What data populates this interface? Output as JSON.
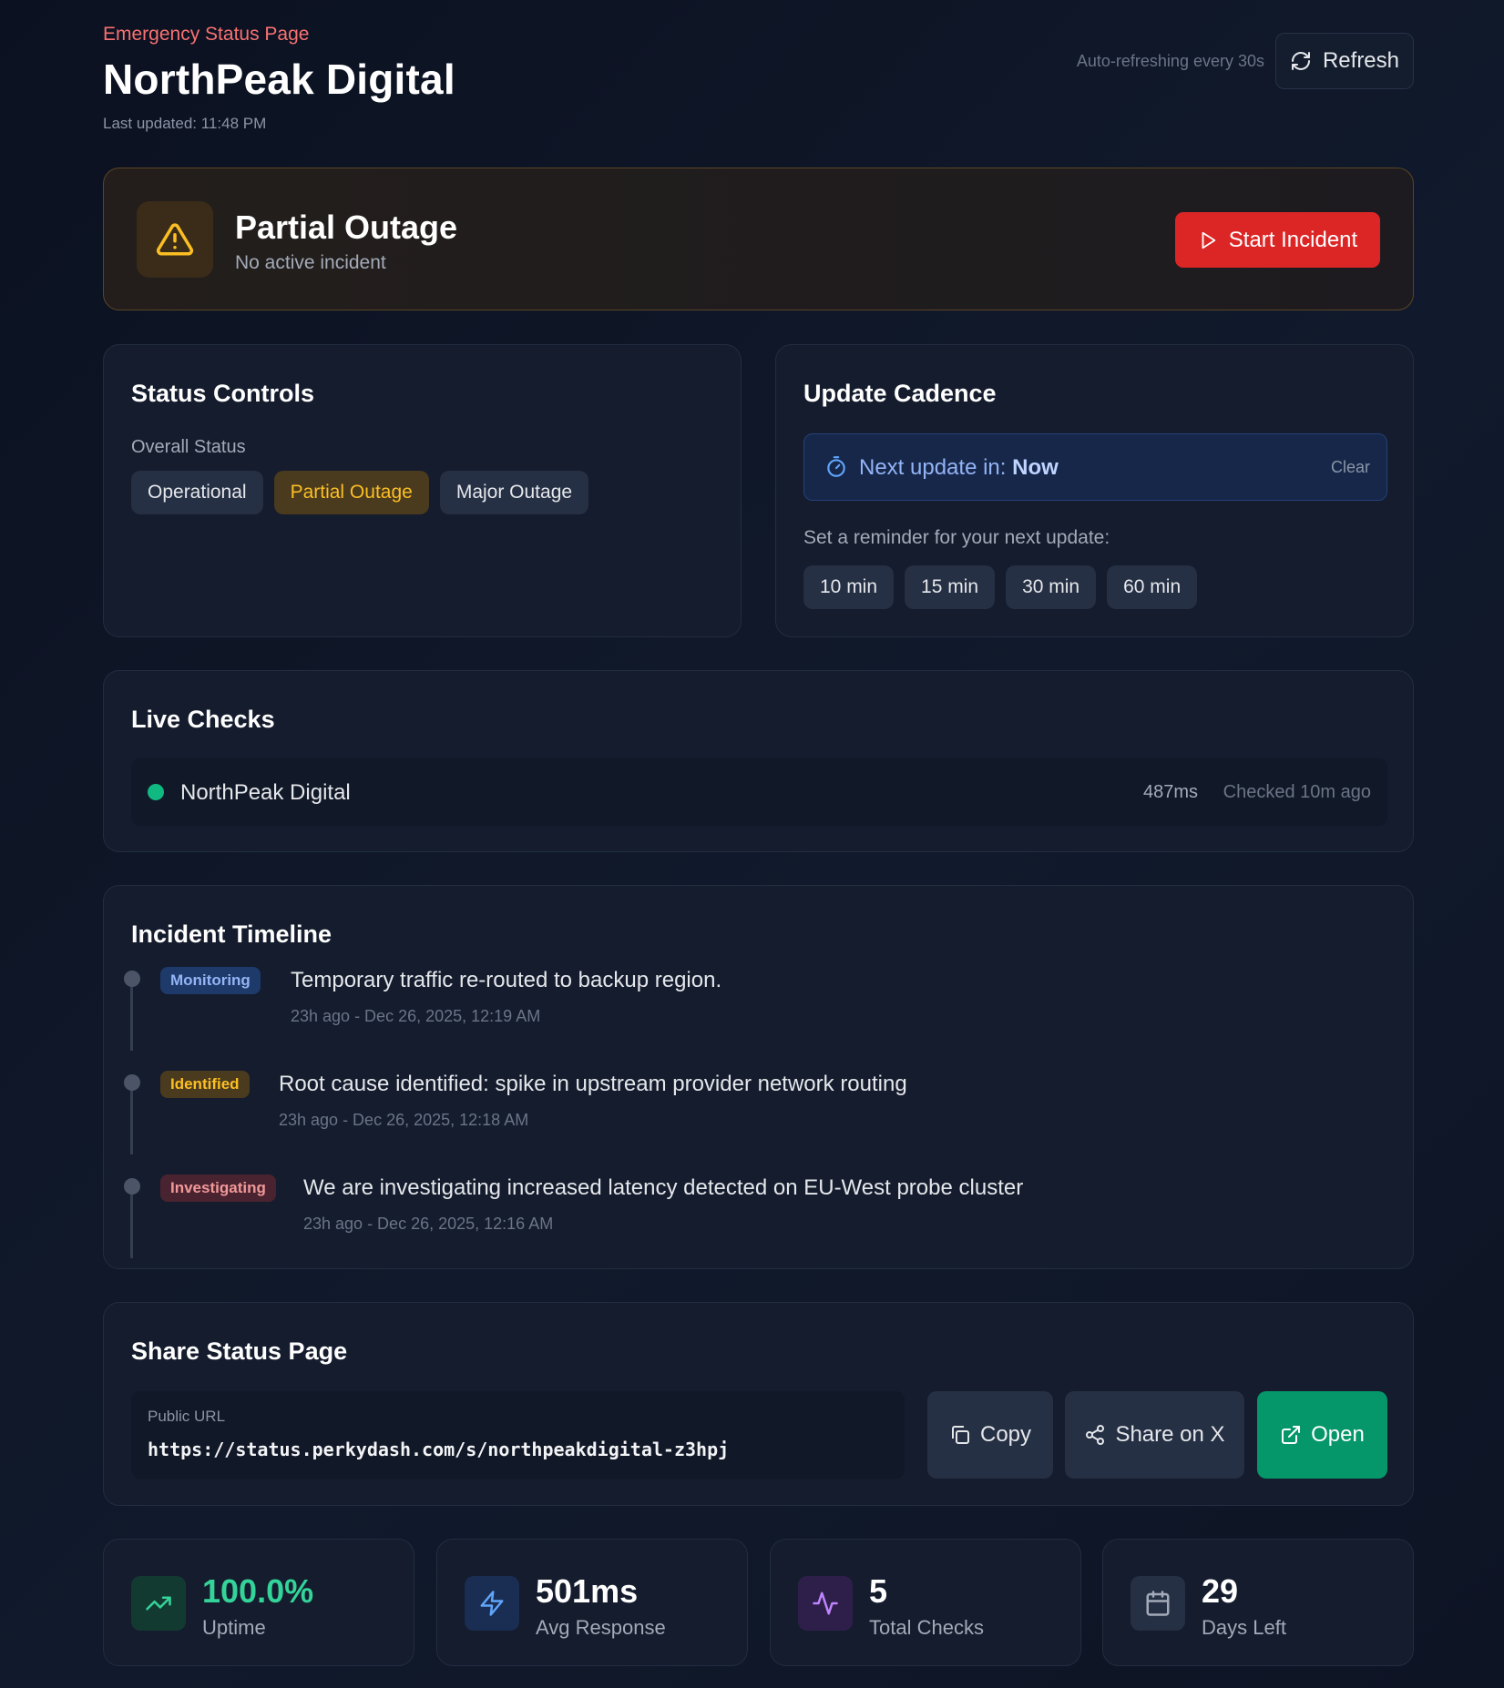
{
  "header": {
    "eyebrow": "Emergency Status Page",
    "title": "NorthPeak Digital",
    "last_updated": "Last updated: 11:48 PM",
    "auto_refresh": "Auto-refreshing every 30s",
    "refresh_label": "Refresh"
  },
  "banner": {
    "title": "Partial Outage",
    "subtitle": "No active incident",
    "start_label": "Start Incident",
    "accent": "#fbbf24"
  },
  "status_controls": {
    "title": "Status Controls",
    "label": "Overall Status",
    "options": [
      "Operational",
      "Partial Outage",
      "Major Outage"
    ],
    "selected": "Partial Outage"
  },
  "cadence": {
    "title": "Update Cadence",
    "next_prefix": "Next update in:",
    "next_value": "Now",
    "clear_label": "Clear",
    "reminder_label": "Set a reminder for your next update:",
    "options": [
      "10 min",
      "15 min",
      "30 min",
      "60 min"
    ]
  },
  "live_checks": {
    "title": "Live Checks",
    "items": [
      {
        "name": "NorthPeak Digital",
        "response": "487ms",
        "checked": "Checked 10m ago",
        "status_color": "#10b981"
      }
    ]
  },
  "timeline": {
    "title": "Incident Timeline",
    "items": [
      {
        "badge": "Monitoring",
        "message": "Temporary traffic re-routed to backup region.",
        "time": "23h ago - Dec 26, 2025, 12:19 AM"
      },
      {
        "badge": "Identified",
        "message": "Root cause identified: spike in upstream provider network routing",
        "time": "23h ago - Dec 26, 2025, 12:18 AM"
      },
      {
        "badge": "Investigating",
        "message": "We are investigating increased latency detected on EU-West probe cluster",
        "time": "23h ago - Dec 26, 2025, 12:16 AM"
      }
    ]
  },
  "share": {
    "title": "Share Status Page",
    "url_label": "Public URL",
    "url": "https://status.perkydash.com/s/northpeakdigital-z3hpj",
    "copy_label": "Copy",
    "share_x_label": "Share on X",
    "open_label": "Open"
  },
  "stats": [
    {
      "value": "100.0%",
      "label": "Uptime",
      "icon": "trending-up-icon",
      "color": "#34d399"
    },
    {
      "value": "501ms",
      "label": "Avg Response",
      "icon": "zap-icon",
      "color": "#ffffff"
    },
    {
      "value": "5",
      "label": "Total Checks",
      "icon": "activity-icon",
      "color": "#ffffff"
    },
    {
      "value": "29",
      "label": "Days Left",
      "icon": "calendar-icon",
      "color": "#ffffff"
    }
  ]
}
